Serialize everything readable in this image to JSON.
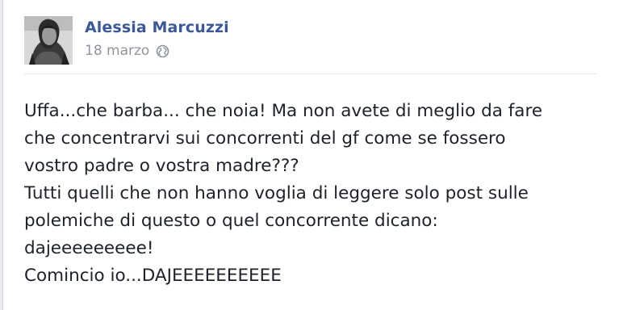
{
  "post": {
    "author": "Alessia Marcuzzi",
    "date": "18 marzo",
    "privacy_icon": "globe-icon",
    "lines": [
      "Uffa...che barba... che noia! Ma non avete di meglio da fare",
      "che concentrarvi sui concorrenti del gf come se fossero",
      "vostro padre o vostra madre???",
      "Tutti quelli che non hanno voglia di leggere solo post sulle",
      "polemiche di questo o quel concorrente dicano:",
      "dajeeeeeeeee!",
      "Comincio io...DAJEEEEEEEEEE"
    ]
  },
  "colors": {
    "author_link": "#3b5998",
    "meta_text": "#90949c",
    "body_text": "#1d2129"
  }
}
